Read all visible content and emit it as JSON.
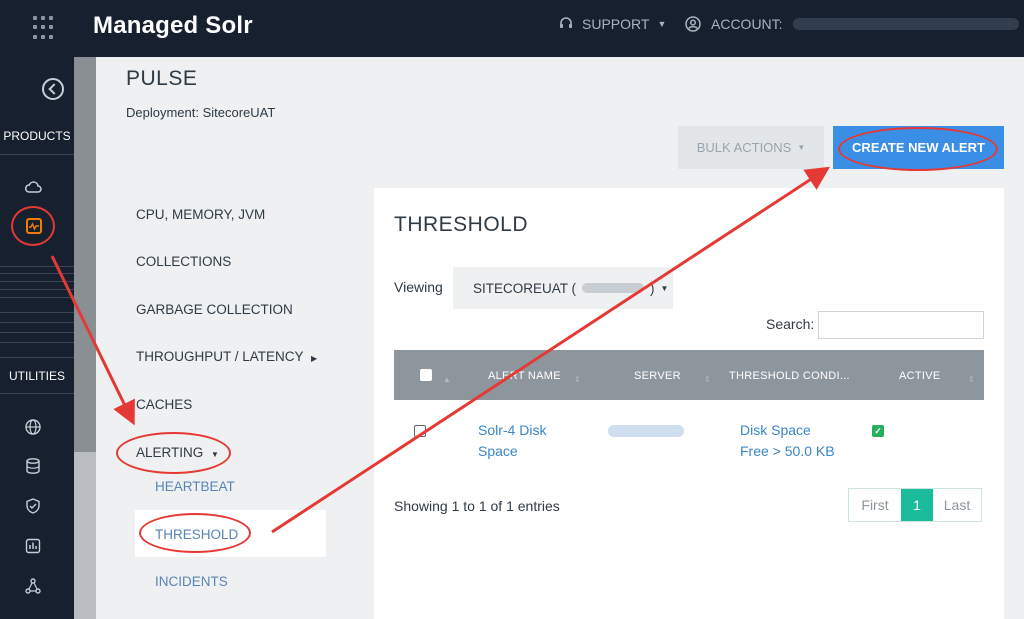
{
  "header": {
    "app_title": "Managed Solr",
    "support_label": "SUPPORT",
    "account_label": "ACCOUNT:"
  },
  "sidebar": {
    "products_label": "PRODUCTS",
    "utilities_label": "UTILITIES",
    "icons": [
      "cloud-icon",
      "pulse-icon",
      "globe-icon",
      "database-icon",
      "shield-icon",
      "chart-icon",
      "network-icon"
    ]
  },
  "page": {
    "title": "PULSE",
    "deployment": "Deployment: SitecoreUAT",
    "bulk_actions_label": "BULK ACTIONS",
    "create_alert_label": "CREATE NEW ALERT"
  },
  "nav": {
    "items": [
      "CPU, MEMORY, JVM",
      "COLLECTIONS",
      "GARBAGE COLLECTION",
      "THROUGHPUT / LATENCY",
      "CACHES",
      "ALERTING"
    ],
    "alerting_sub": [
      "HEARTBEAT",
      "THRESHOLD",
      "INCIDENTS"
    ]
  },
  "threshold": {
    "title": "THRESHOLD",
    "viewing_label": "Viewing",
    "viewing_value_prefix": "SITECOREUAT (",
    "viewing_value_suffix": ")",
    "search_label": "Search:",
    "columns": [
      "ALERT NAME",
      "SERVER",
      "THRESHOLD CONDI...",
      "ACTIVE"
    ],
    "rows": [
      {
        "alert_name_line1": "Solr-4 Disk",
        "alert_name_line2": "Space",
        "condition_line1": "Disk Space",
        "condition_line2": "Free > 50.0 KB",
        "active": true
      }
    ],
    "showing": "Showing 1 to 1 of 1 entries",
    "pager": {
      "first": "First",
      "current": "1",
      "last": "Last"
    }
  },
  "colors": {
    "topbar": "#16202e",
    "primary_button": "#3a8ee6",
    "pager_active": "#1abc9c",
    "annotation": "#e53935",
    "active_check": "#27ae60"
  }
}
